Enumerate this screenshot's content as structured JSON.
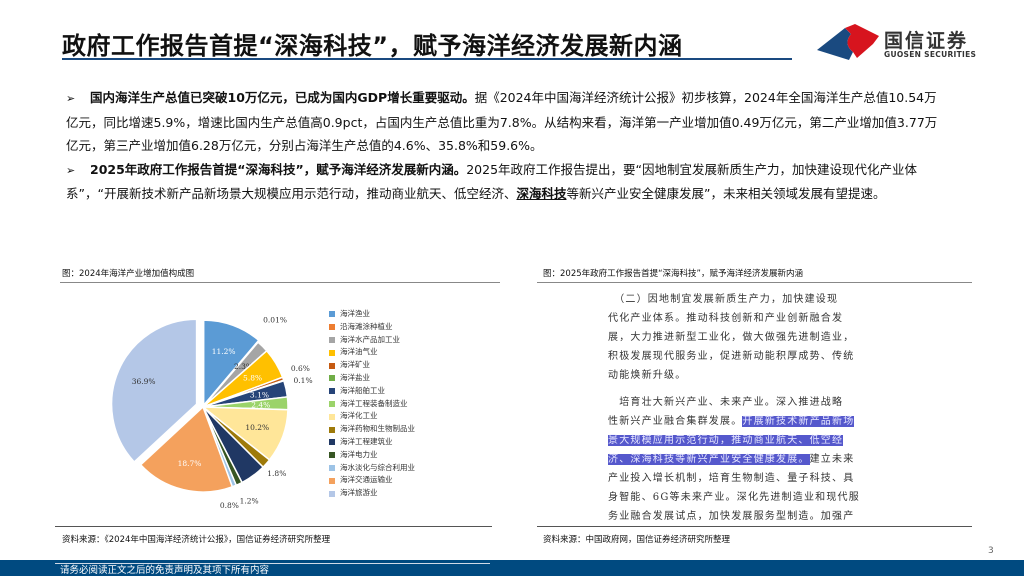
{
  "header": {
    "title": "政府工作报告首提“深海科技”，赋予海洋经济发展新内涵",
    "logo_cn": "国信证券",
    "logo_en": "GUOSEN SECURITIES",
    "colors": {
      "brand_blue": "#1a4a80",
      "brand_red": "#d7141e"
    }
  },
  "body": {
    "p1_bold": "国内海洋生产总值已突破10万亿元，已成为国内GDP增长重要驱动。",
    "p1_text": "据《2024年中国海洋经济统计公报》初步核算，2024年全国海洋生产总值10.54万亿元，同比增速5.9%，增速比国内生产总值高0.9pct，占国内生产总值比重为7.8%。从结构来看，海洋第一产业增加值0.49万亿元，第二产业增加值3.77万亿元，第三产业增加值6.28万亿元，分别占海洋生产总值的4.6%、35.8%和59.6%。",
    "p2_bold": "2025年政府工作报告首提“深海科技”，赋予海洋经济发展新内涵。",
    "p2_text_a": "2025年政府工作报告提出，要“因地制宜发展新质生产力，加快建设现代化产业体系”，“开展新技术新产品新场景大规模应用示范行动，推动商业航天、低空经济、",
    "p2_underline": "深海科技",
    "p2_text_b": "等新兴产业安全健康发展”，未来相关领域发展有望提速。",
    "bullet": "➢"
  },
  "left_figure": {
    "caption": "图：2024年海洋产业增加值构成图",
    "source": "资料来源：《2024年中国海洋经济统计公报》，国信证券经济研究所整理"
  },
  "right_figure": {
    "caption": "图：2025年政府工作报告首提“深海科技”，赋予海洋经济发展新内涵",
    "source": "资料来源：中国政府网，国信证券经济研究所整理",
    "doc_lines": [
      {
        "pre": "　（二）因地制宜发展新质生产力，加快建设现",
        "hl": "",
        "post": ""
      },
      {
        "pre": "代化产业体系。推动科技创新和产业创新融合发",
        "hl": "",
        "post": ""
      },
      {
        "pre": "展，大力推进新型工业化，做大做强先进制造业，",
        "hl": "",
        "post": ""
      },
      {
        "pre": "积极发展现代服务业，促进新动能积厚成势、传统",
        "hl": "",
        "post": ""
      },
      {
        "pre": "动能焕新升级。",
        "hl": "",
        "post": ""
      },
      {
        "pre": "　培育壮大新兴产业、未来产业。深入推进战略",
        "hl": "",
        "post": ""
      },
      {
        "pre": "性新兴产业融合集群发展。",
        "hl": "开展新技术新产品新场",
        "post": ""
      },
      {
        "pre": "",
        "hl": "景大规模应用示范行动，推动商业航天、低空经",
        "post": ""
      },
      {
        "pre": "",
        "hl": "济、深海科技等新兴产业安全健康发展。",
        "post": "建立未来"
      },
      {
        "pre": "产业投入增长机制，培育生物制造、量子科技、具",
        "hl": "",
        "post": ""
      },
      {
        "pre": "身智能、6G等未来产业。深化先进制造业和现代服",
        "hl": "",
        "post": ""
      },
      {
        "pre": "务业融合发展试点，加快发展服务型制造。加强产",
        "hl": "",
        "post": ""
      }
    ],
    "highlight_color": "#5558cc"
  },
  "chart_data": {
    "type": "pie",
    "title": "2024年海洋产业增加值构成图",
    "unit": "%",
    "legend_placement": "right",
    "categories": [
      "海洋渔业",
      "沿海滩涂种植业",
      "海洋水产品加工业",
      "海洋油气业",
      "海洋矿业",
      "海洋盐业",
      "海洋船舶工业",
      "海洋工程装备制造业",
      "海洋化工业",
      "海洋药物和生物制品业",
      "海洋工程建筑业",
      "海洋电力业",
      "海水淡化与综合利用业",
      "海洋交通运输业",
      "海洋旅游业"
    ],
    "values": [
      11.2,
      0.01,
      2.3,
      5.8,
      0.6,
      0.1,
      3.1,
      2.4,
      10.2,
      1.8,
      4.9,
      1.2,
      0.8,
      18.7,
      36.9
    ],
    "labels": [
      "11.2%",
      "0.01%",
      "2.3%",
      "5.8%",
      "0.6%",
      "0.1%",
      "3.1%",
      "2.4%",
      "10.2%",
      "1.8%",
      "",
      "1.2%",
      "0.8%",
      "18.7%",
      "36.9%"
    ],
    "colors": [
      "#5b9bd5",
      "#ed7d31",
      "#a5a5a5",
      "#ffc000",
      "#c55a11",
      "#70ad47",
      "#264478",
      "#9bd36a",
      "#ffe699",
      "#9e7a0a",
      "#203864",
      "#375623",
      "#9dc3e6",
      "#f4a15d",
      "#b4c7e7"
    ]
  },
  "footer": {
    "disclaimer": "请务必阅读正文之后的免责声明及其项下所有内容",
    "page_number": "3"
  }
}
